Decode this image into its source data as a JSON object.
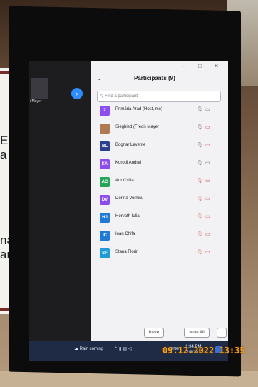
{
  "meeting": {
    "window_controls": [
      "–",
      "□",
      "✕"
    ],
    "participants_title": "Participants (9)",
    "search_placeholder": "Find a participant",
    "video_name": "i Mayer",
    "participants": [
      {
        "initials": "Z",
        "name": "Primăria Arad (Host, me)",
        "color": "#8b4cf0",
        "mic": "on",
        "cam": "on"
      },
      {
        "initials": "",
        "name": "Sieghied (Fredi) Mayer",
        "color": "#b07a52",
        "mic": "on",
        "cam": "off"
      },
      {
        "initials": "BL",
        "name": "Bognar Levente",
        "color": "#2a3f8f",
        "mic": "on",
        "cam": "off"
      },
      {
        "initials": "KA",
        "name": "Korodi Andrei",
        "color": "#8b4cf0",
        "mic": "on",
        "cam": "on"
      },
      {
        "initials": "AC",
        "name": "Aur Csilla",
        "color": "#25a55a",
        "mic": "off",
        "cam": "off"
      },
      {
        "initials": "DV",
        "name": "Dorina Vornicu",
        "color": "#8b4cf0",
        "mic": "off",
        "cam": "off"
      },
      {
        "initials": "HJ",
        "name": "Horvath Iulia",
        "color": "#1f7ad6",
        "mic": "off",
        "cam": "off"
      },
      {
        "initials": "IC",
        "name": "Ioan Chifa",
        "color": "#1f7ad6",
        "mic": "off",
        "cam": "off"
      },
      {
        "initials": "SF",
        "name": "Stana Florin",
        "color": "#1f9bd6",
        "mic": "off",
        "cam": "off"
      }
    ],
    "invite_label": "Invite",
    "mute_all_label": "Mute All",
    "more_label": "..."
  },
  "taskbar": {
    "weather": "Rain coming",
    "lang": "ENG",
    "time": "1:34 PM",
    "date": "12/8/2022"
  },
  "slide": {
    "fragments": [
      "E",
      "a",
      "na",
      "an"
    ]
  },
  "photo_stamp": "09.12.2022 13:35",
  "colors": {
    "accent": "#2d8cff",
    "muted_red": "#d9534f",
    "taskbar": "#1f2b45"
  }
}
